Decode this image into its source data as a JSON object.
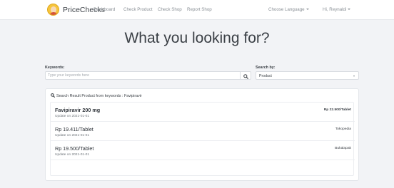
{
  "navbar": {
    "brand": "PriceChecks",
    "links": [
      "Dashboard",
      "Check Product",
      "Check Shop",
      "Report Shop"
    ],
    "language": "Choose Language",
    "user": "Hi, Reynaldi"
  },
  "hero": {
    "title": "What you looking for?"
  },
  "search": {
    "keywords_label": "Keywords:",
    "keywords_placeholder": "Type your keywords here",
    "keywords_value": "",
    "search_by_label": "Search by:",
    "search_by_selected": "Product",
    "search_icon": "search-icon"
  },
  "results": {
    "header": "Search Result Product from keywords : Favipiravir",
    "product": {
      "name": "Favipiravir 200 mg",
      "update": "Update on 2021-01-01",
      "price": "Rp 22.500/Tablet"
    },
    "shops": [
      {
        "price": "Rp 19.411/Tablet",
        "update": "Update on 2021-01-01",
        "shop": "Tokopedia"
      },
      {
        "price": "Rp 19.500/Tablet",
        "update": "Update on 2021-01-01",
        "shop": "Bukalapak"
      }
    ]
  },
  "colors": {
    "background": "#f2f3f6",
    "card": "#ffffff",
    "text": "#3a3f45",
    "muted": "#8a9096",
    "logo": "#f6c53d"
  }
}
